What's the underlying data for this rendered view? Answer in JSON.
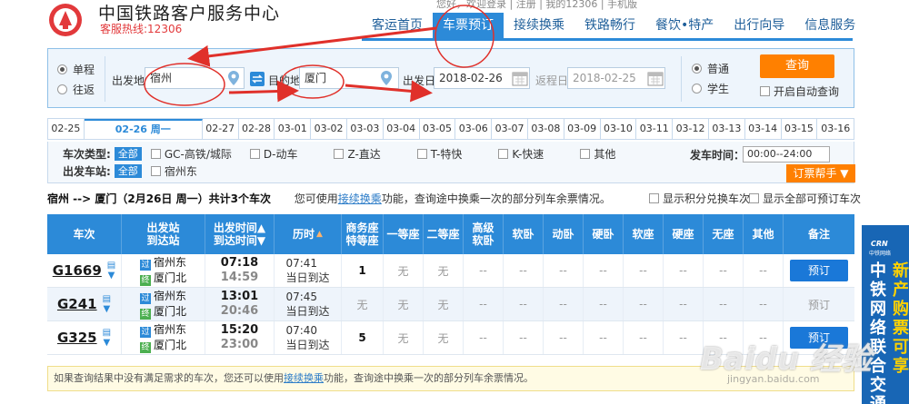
{
  "header": {
    "site_title": "中国铁路客户服务中心",
    "hotline": "客服热线:12306",
    "top_links": "您好，欢迎登录 | 注册 | 我的12306 | 手机版",
    "nav": [
      {
        "label": "客运首页",
        "active": false
      },
      {
        "label": "车票预订",
        "active": true
      },
      {
        "label": "接续换乘",
        "active": false
      },
      {
        "label": "铁路畅行",
        "active": false
      },
      {
        "label": "餐饮•特产",
        "active": false
      },
      {
        "label": "出行向导",
        "active": false
      },
      {
        "label": "信息服务",
        "active": false
      }
    ]
  },
  "search": {
    "trip_one_way": "单程",
    "trip_round": "往返",
    "from_label": "出发地",
    "from_value": "宿州",
    "to_label": "目的地",
    "to_value": "厦门",
    "depart_label": "出发日",
    "depart_value": "2018-02-26",
    "return_label": "返程日",
    "return_value": "2018-02-25",
    "type_normal": "普通",
    "type_student": "学生",
    "query_button": "查询",
    "auto_query": "开启自动查询"
  },
  "date_tabs": [
    "02-25",
    "02-26 周一",
    "02-27",
    "02-28",
    "03-01",
    "03-02",
    "03-03",
    "03-04",
    "03-05",
    "03-06",
    "03-07",
    "03-08",
    "03-09",
    "03-10",
    "03-11",
    "03-12",
    "03-13",
    "03-14",
    "03-15",
    "03-16"
  ],
  "filter": {
    "type_label": "车次类型:",
    "all": "全部",
    "types": [
      "GC-高铁/城际",
      "D-动车",
      "Z-直达",
      "T-特快",
      "K-快速",
      "其他"
    ],
    "station_label": "出发车站:",
    "stations": [
      "宿州东"
    ],
    "time_label": "发车时间：",
    "time_value": "00:00--24:00",
    "helper_button": "订票帮手 ▼"
  },
  "summary": {
    "route": "宿州 --> 厦门（2月26日 周一）共计3个车次",
    "tip_prefix": "您可使用",
    "tip_link": "接续换乘",
    "tip_suffix": "功能，查询途中换乘一次的部分列车余票情况。",
    "opt_points": "显示积分兑换车次",
    "opt_all": "显示全部可预订车次"
  },
  "table": {
    "headers": {
      "train": "车次",
      "station_a": "出发站",
      "station_b": "到达站",
      "time_a": "出发时间▲",
      "time_b": "到达时间▼",
      "duration": "历时",
      "business_a": "商务座",
      "business_b": "特等座",
      "first": "一等座",
      "second": "二等座",
      "senior_a": "高级",
      "senior_b": "软卧",
      "soft_sleeper": "软卧",
      "moving_sleeper": "动卧",
      "hard_sleeper": "硬卧",
      "soft_seat": "软座",
      "hard_seat": "硬座",
      "no_seat": "无座",
      "other": "其他",
      "remark": "备注"
    },
    "rows": [
      {
        "train": "G1669",
        "from": "宿州东",
        "to": "厦门北",
        "dep": "07:18",
        "arr": "14:59",
        "dur": "07:41",
        "day": "当日到达",
        "cells": [
          "1",
          "无",
          "无",
          "--",
          "--",
          "--",
          "--",
          "--",
          "--",
          "--",
          "--"
        ],
        "remark": "预订",
        "bookable": true
      },
      {
        "train": "G241",
        "from": "宿州东",
        "to": "厦门北",
        "dep": "13:01",
        "arr": "20:46",
        "dur": "07:45",
        "day": "当日到达",
        "cells": [
          "无",
          "无",
          "无",
          "--",
          "--",
          "--",
          "--",
          "--",
          "--",
          "--",
          "--"
        ],
        "remark": "预订",
        "bookable": false
      },
      {
        "train": "G325",
        "from": "宿州东",
        "to": "厦门北",
        "dep": "15:20",
        "arr": "23:00",
        "dur": "07:40",
        "day": "当日到达",
        "cells": [
          "5",
          "无",
          "无",
          "--",
          "--",
          "--",
          "--",
          "--",
          "--",
          "--",
          "--"
        ],
        "remark": "预订",
        "bookable": true
      }
    ]
  },
  "note": {
    "prefix": "如果查询结果中没有满足需求的车次，您还可以使用",
    "link": "接续换乘",
    "suffix": "功能，查询途中换乘一次的部分列车余票情况。"
  },
  "ad": {
    "logo": "CRN",
    "sub": "中铁网络",
    "col1": "中铁网络联合交通",
    "col2": "新产购票可享"
  },
  "watermark": {
    "main": "Baidu 经验",
    "sub": "jingyan.baidu.com"
  },
  "colors": {
    "accent": "#2c8ad8",
    "orange": "#ff8000",
    "annotation": "#e0302a"
  }
}
